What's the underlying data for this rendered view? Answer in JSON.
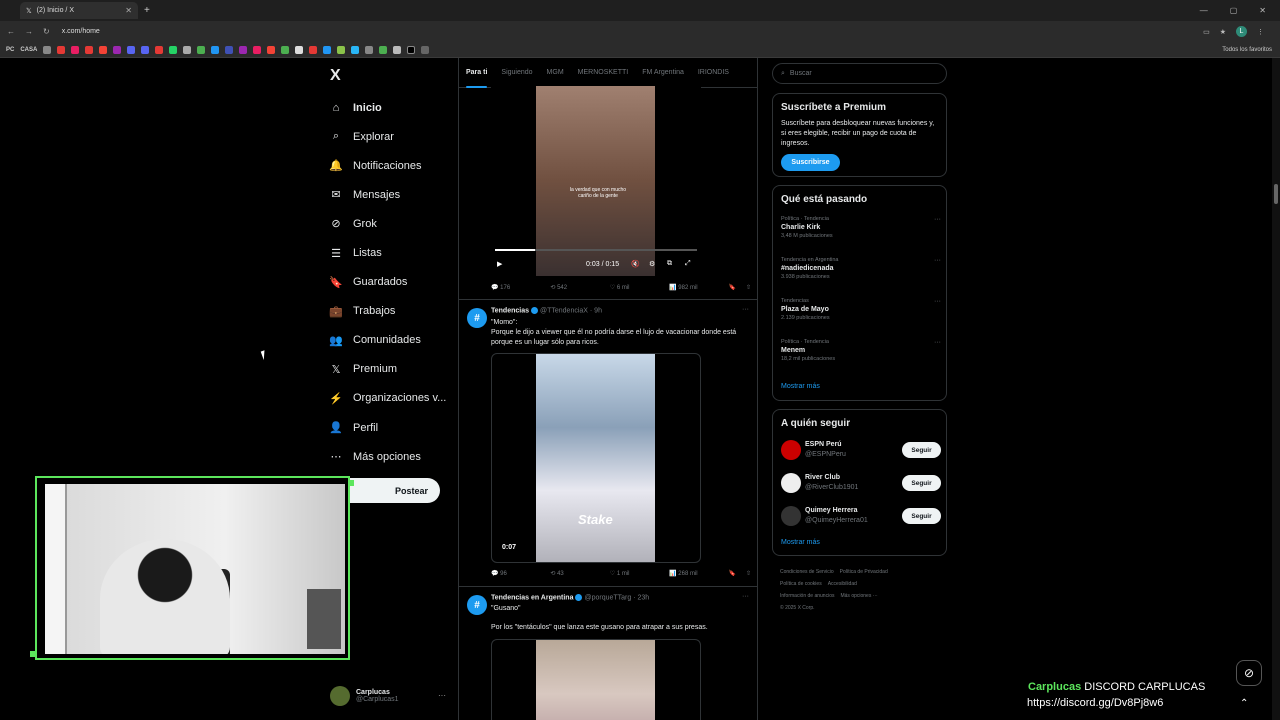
{
  "browser": {
    "tab_title": "(2) Inicio / X",
    "url": "x.com/home",
    "bookmark_labels": [
      "PC",
      "CASA"
    ],
    "all_bookmarks": "Todos los favoritos",
    "profile_initial": "L"
  },
  "sidebar": {
    "logo": "X",
    "items": [
      {
        "label": "Inicio",
        "icon": "home-icon",
        "glyph": "⌂"
      },
      {
        "label": "Explorar",
        "icon": "search-icon",
        "glyph": "⌕"
      },
      {
        "label": "Notificaciones",
        "icon": "bell-icon",
        "glyph": "🔔"
      },
      {
        "label": "Mensajes",
        "icon": "mail-icon",
        "glyph": "✉"
      },
      {
        "label": "Grok",
        "icon": "grok-icon",
        "glyph": "⊘"
      },
      {
        "label": "Listas",
        "icon": "list-icon",
        "glyph": "☰"
      },
      {
        "label": "Guardados",
        "icon": "bookmark-icon",
        "glyph": "🔖"
      },
      {
        "label": "Trabajos",
        "icon": "briefcase-icon",
        "glyph": "💼"
      },
      {
        "label": "Comunidades",
        "icon": "people-icon",
        "glyph": "👥"
      },
      {
        "label": "Premium",
        "icon": "x-logo-icon",
        "glyph": "𝕏"
      },
      {
        "label": "Organizaciones v...",
        "icon": "lightning-icon",
        "glyph": "⚡"
      },
      {
        "label": "Perfil",
        "icon": "person-icon",
        "glyph": "👤"
      },
      {
        "label": "Más opciones",
        "icon": "more-circle-icon",
        "glyph": "⋯"
      }
    ],
    "post_button": "Postear",
    "account": {
      "name": "Carplucas",
      "handle": "@Carplucas1"
    }
  },
  "feed": {
    "tabs": [
      "Para ti",
      "Siguiendo",
      "MGM",
      "MERNOSKETTI",
      "FM Argentina",
      "IRIONDIS"
    ],
    "active_tab": 0,
    "video1": {
      "caption": "la verdad que con mucho cariño de la gente",
      "time": "0:03 / 0:15",
      "progress": 0.2,
      "actions": {
        "replies": "176",
        "reposts": "542",
        "likes": "6 mil",
        "views": "982 mil"
      }
    },
    "tweets": [
      {
        "name": "Tendencias",
        "handle": "@TTendenciaX · 9h",
        "avatar_glyph": "#",
        "text1": "\"Momo\":",
        "text2": "Porque le dijo a viewer que él no podría darse el lujo de vacacionar donde está porque es un lugar sólo para ricos.",
        "video_overlay": "Stake",
        "video_time": "0:07",
        "actions": {
          "replies": "96",
          "reposts": "43",
          "likes": "1 mil",
          "views": "268 mil"
        }
      },
      {
        "name": "Tendencias en Argentina",
        "handle": "@porqueTTarg · 23h",
        "avatar_glyph": "#",
        "text1": "\"Gusano\"",
        "text2": "Por los \"tentáculos\" que lanza este gusano para atrapar a sus presas."
      }
    ]
  },
  "right": {
    "search_placeholder": "Buscar",
    "premium": {
      "title": "Suscríbete a Premium",
      "body": "Suscríbete para desbloquear nuevas funciones y, si eres elegible, recibir un pago de cuota de ingresos.",
      "button": "Suscribirse"
    },
    "trends": {
      "title": "Qué está pasando",
      "items": [
        {
          "category": "Política · Tendencia",
          "topic": "Charlie Kirk",
          "count": "3,48 M publicaciones"
        },
        {
          "category": "Tendencia en Argentina",
          "topic": "#nadiedicenada",
          "count": "3.938 publicaciones"
        },
        {
          "category": "Tendencias",
          "topic": "Plaza de Mayo",
          "count": "2.139 publicaciones"
        },
        {
          "category": "Política · Tendencia",
          "topic": "Menem",
          "count": "18,2 mil publicaciones"
        }
      ],
      "show_more": "Mostrar más"
    },
    "follow": {
      "title": "A quién seguir",
      "items": [
        {
          "name": "ESPN Perú",
          "handle": "@ESPNPeru",
          "color": "#cc0000"
        },
        {
          "name": "River Club",
          "handle": "@RiverClub1901",
          "color": "#eeeeee"
        },
        {
          "name": "Quimey Herrera",
          "handle": "@QuimeyHerrera01",
          "color": "#333333"
        }
      ],
      "button": "Seguir",
      "show_more": "Mostrar más"
    },
    "footer": [
      "Condiciones de Servicio",
      "Política de Privacidad",
      "Política de cookies",
      "Accesibilidad",
      "Información de anuncios",
      "Más opciones ···",
      "© 2025 X Corp."
    ]
  },
  "overlay": {
    "discord_name": "Carplucas",
    "discord_label": "DISCORD CARPLUCAS",
    "discord_url": "https://discord.gg/Dv8Pj8w6"
  },
  "colors": {
    "accent": "#1d9bf0",
    "cam_border": "#5ce65c"
  }
}
